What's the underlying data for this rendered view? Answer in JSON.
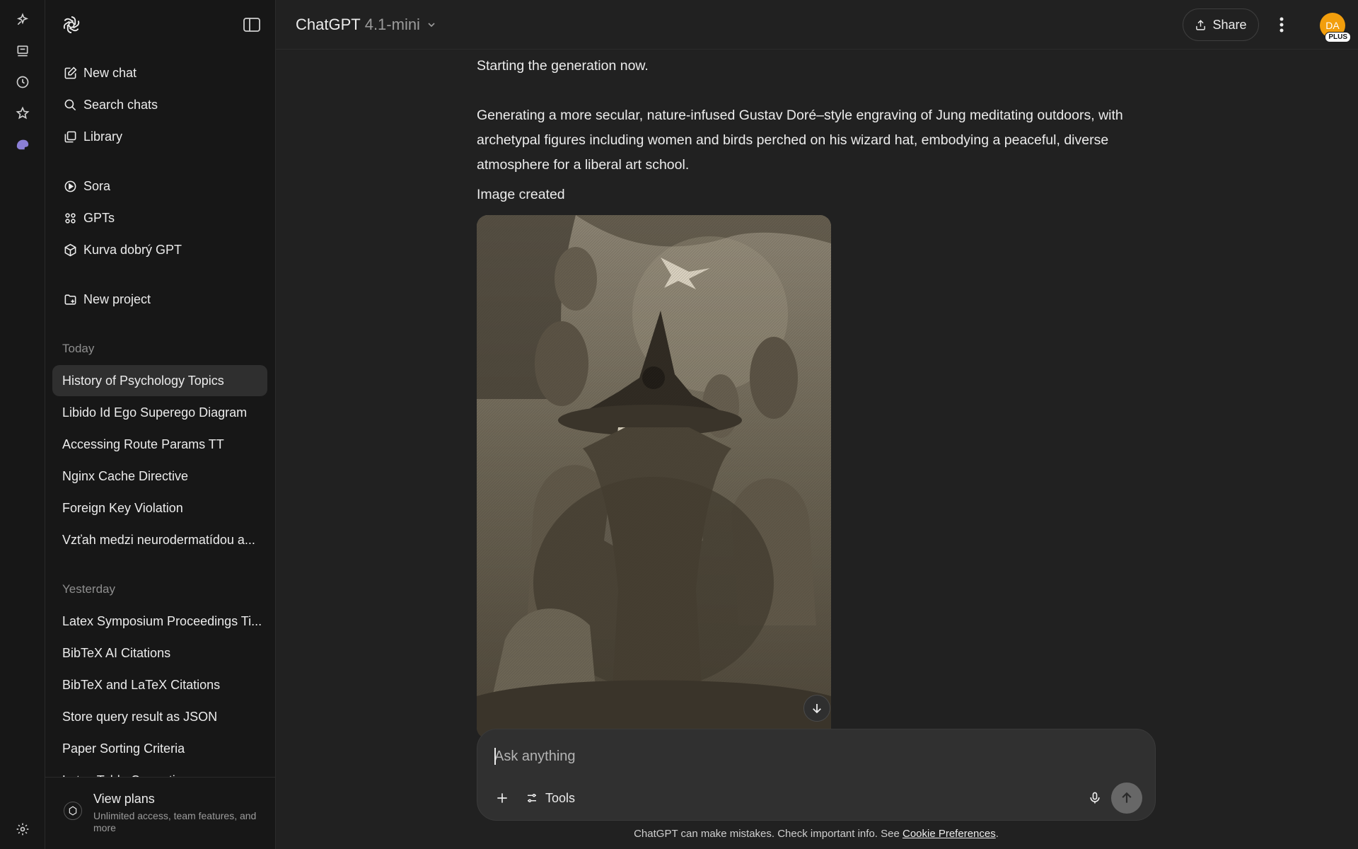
{
  "rail": {
    "icons": [
      "sparkle-edit-icon",
      "inbox-icon",
      "history-icon",
      "star-icon",
      "extension-icon",
      "settings-icon"
    ]
  },
  "sidebar": {
    "nav": [
      {
        "label": "New chat",
        "icon": "new-chat-icon"
      },
      {
        "label": "Search chats",
        "icon": "search-icon"
      },
      {
        "label": "Library",
        "icon": "library-icon"
      }
    ],
    "apps": [
      {
        "label": "Sora",
        "icon": "play-icon"
      },
      {
        "label": "GPTs",
        "icon": "grid-icon"
      },
      {
        "label": "Kurva dobrý GPT",
        "icon": "cube-icon"
      }
    ],
    "new_project": "New project",
    "sections": [
      {
        "title": "Today",
        "items": [
          "History of Psychology Topics",
          "Libido Id Ego Superego Diagram",
          "Accessing Route Params TT",
          "Nginx Cache Directive",
          "Foreign Key Violation",
          "Vzťah medzi neurodermatídou a..."
        ]
      },
      {
        "title": "Yesterday",
        "items": [
          "Latex Symposium Proceedings Ti...",
          "BibTeX AI Citations",
          "BibTeX and LaTeX Citations",
          "Store query result as JSON",
          "Paper Sorting Criteria",
          "Latex Table Correction"
        ]
      }
    ],
    "plans": {
      "title": "View plans",
      "subtitle": "Unlimited access, team features, and more"
    }
  },
  "header": {
    "model_name": "ChatGPT",
    "model_version": "4.1-mini",
    "share_label": "Share",
    "avatar_initials": "DA",
    "plan_badge": "PLUS"
  },
  "chat": {
    "line1": "Starting the generation now.",
    "line2": "Generating a more secular, nature-infused Gustav Doré–style engraving of Jung meditating outdoors, with archetypal figures including women and birds perched on his wizard hat, embodying a peaceful, diverse atmosphere for a liberal art school.",
    "line3": "Image created"
  },
  "composer": {
    "placeholder": "Ask anything",
    "tools_label": "Tools"
  },
  "footer": {
    "text": "ChatGPT can make mistakes. Check important info. See ",
    "link": "Cookie Preferences",
    "end": "."
  },
  "colors": {
    "background": "#212121",
    "sidebar": "#171717",
    "composer": "#303030",
    "avatar": "#f29e0c"
  }
}
